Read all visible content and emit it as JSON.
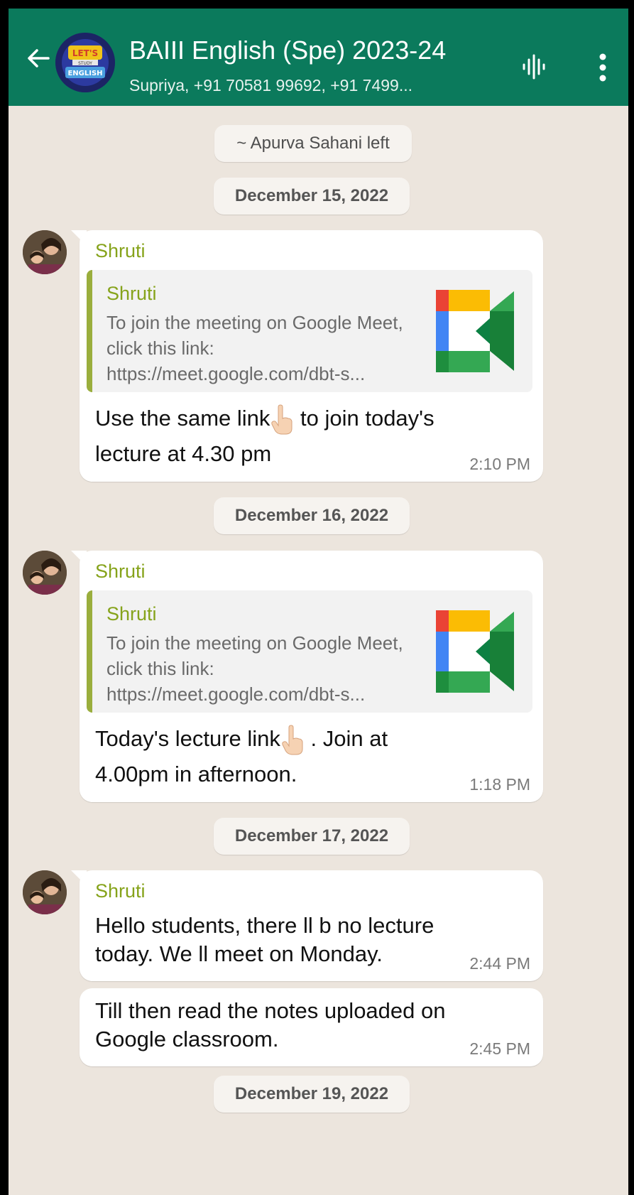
{
  "header": {
    "title": "BAIII English (Spe) 2023-24",
    "subtitle": "Supriya, +91 70581 99692, +91 7499...",
    "avatar_text": "LET'S STUDY ENGLISH"
  },
  "chat": {
    "system_notice": "~ Apurva Sahani left",
    "sections": [
      {
        "date": "December 15, 2022",
        "messages": [
          {
            "sender": "Shruti",
            "quote_sender": "Shruti",
            "quote_text": "To join the meeting on Google Meet, click this link: https://meet.google.com/dbt-s...",
            "text_line1_a": "Use the same link",
            "text_line1_b": " to join today's",
            "text_line2": "lecture at 4.30 pm",
            "time": "2:10 PM"
          }
        ]
      },
      {
        "date": "December 16, 2022",
        "messages": [
          {
            "sender": "Shruti",
            "quote_sender": "Shruti",
            "quote_text": "To join the meeting on Google Meet, click this link: https://meet.google.com/dbt-s...",
            "text_line1_a": "Today's lecture link",
            "text_line1_b": " . Join at",
            "text_line2": "4.00pm in afternoon.",
            "time": "1:18 PM"
          }
        ]
      },
      {
        "date": "December 17, 2022",
        "messages": [
          {
            "sender": "Shruti",
            "text": "Hello students, there ll b no lecture today. We ll meet on Monday.",
            "time": "2:44 PM"
          },
          {
            "text": "Till then read the notes uploaded on Google classroom.",
            "time": "2:45 PM"
          }
        ]
      },
      {
        "date": "December 19, 2022"
      }
    ]
  },
  "colors": {
    "header_bg": "#0b7a5c",
    "chat_bg": "#ece5dd",
    "sender_name": "#86a31b",
    "quote_bar": "#9aae3d"
  },
  "icons": [
    "back-arrow-icon",
    "voice-waveform-icon",
    "more-options-icon",
    "google-meet-icon",
    "pointing-hand-icon"
  ]
}
